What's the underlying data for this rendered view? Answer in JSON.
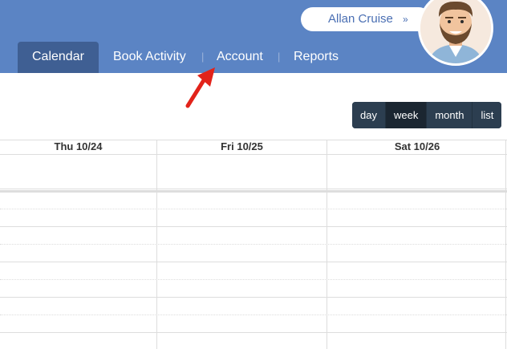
{
  "user": {
    "name": "Allan Cruise"
  },
  "nav": {
    "tabs": [
      {
        "label": "Calendar",
        "active": true
      },
      {
        "label": "Book Activity",
        "active": false
      },
      {
        "label": "Account",
        "active": false
      },
      {
        "label": "Reports",
        "active": false
      }
    ],
    "separator": "|"
  },
  "views": [
    {
      "label": "day",
      "active": false
    },
    {
      "label": "week",
      "active": true
    },
    {
      "label": "month",
      "active": false
    },
    {
      "label": "list",
      "active": false
    }
  ],
  "calendar": {
    "columns": [
      "Thu 10/24",
      "Fri 10/25",
      "Sat 10/26"
    ]
  },
  "colors": {
    "header_bg": "#5b84c4",
    "active_tab": "#3f5f93",
    "view_buttons": "#2c3e50",
    "annotation_arrow": "#e2231a"
  },
  "icons": {
    "user_menu": "chevron-down-icon",
    "annotation": "red-arrow-icon"
  }
}
